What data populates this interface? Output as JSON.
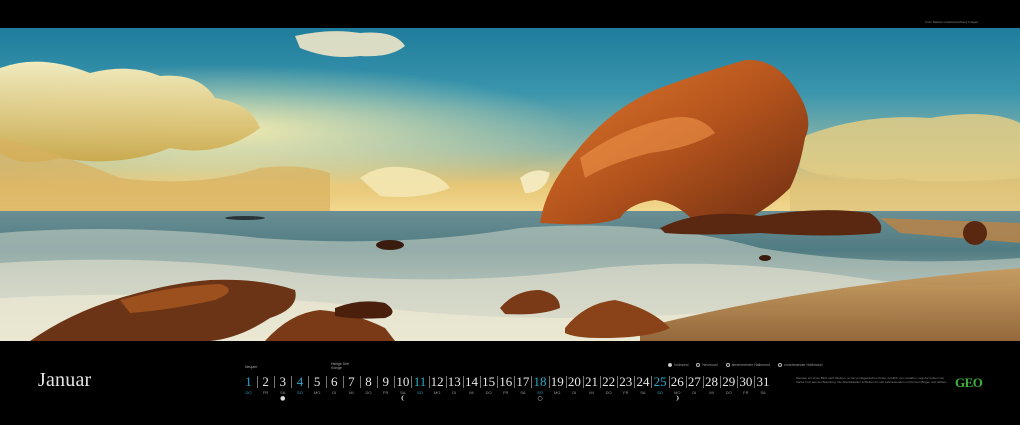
{
  "credit": "Foto: Markus Landsmann/Getty Images",
  "month": "Januar",
  "holidays": [
    {
      "day": 1,
      "label": "Neujahr"
    },
    {
      "day": 6,
      "label": "Heilige Drei Könige"
    }
  ],
  "moon_legend": [
    "Vollmond",
    "Neumond",
    "abnehmender Halbmond",
    "zunehmender Halbmond"
  ],
  "days": [
    {
      "n": "1",
      "wd": "DO",
      "blue": true
    },
    {
      "n": "2",
      "wd": "FR"
    },
    {
      "n": "3",
      "wd": "SA",
      "mark": "●"
    },
    {
      "n": "4",
      "wd": "SO",
      "blue": true
    },
    {
      "n": "5",
      "wd": "MO"
    },
    {
      "n": "6",
      "wd": "DI"
    },
    {
      "n": "7",
      "wd": "MI"
    },
    {
      "n": "8",
      "wd": "DO"
    },
    {
      "n": "9",
      "wd": "FR"
    },
    {
      "n": "10",
      "wd": "SA",
      "mark": "❨"
    },
    {
      "n": "11",
      "wd": "SO",
      "blue": true
    },
    {
      "n": "12",
      "wd": "MO"
    },
    {
      "n": "13",
      "wd": "DI"
    },
    {
      "n": "14",
      "wd": "MI"
    },
    {
      "n": "15",
      "wd": "DO"
    },
    {
      "n": "16",
      "wd": "FR"
    },
    {
      "n": "17",
      "wd": "SA"
    },
    {
      "n": "18",
      "wd": "SO",
      "blue": true,
      "mark": "○"
    },
    {
      "n": "19",
      "wd": "MO"
    },
    {
      "n": "20",
      "wd": "DI"
    },
    {
      "n": "21",
      "wd": "MI"
    },
    {
      "n": "22",
      "wd": "DO"
    },
    {
      "n": "23",
      "wd": "FR"
    },
    {
      "n": "24",
      "wd": "SA"
    },
    {
      "n": "25",
      "wd": "SO",
      "blue": true
    },
    {
      "n": "26",
      "wd": "MO",
      "mark": "❩"
    },
    {
      "n": "27",
      "wd": "DI"
    },
    {
      "n": "28",
      "wd": "MI"
    },
    {
      "n": "29",
      "wd": "DO"
    },
    {
      "n": "30",
      "wd": "FR"
    },
    {
      "n": "31",
      "wd": "SA"
    }
  ],
  "caption": "Wenden wir einen Blick nach Westen: an der portugiesischen Küste, nördlich von Lissabon, ragt der Felsen von Santa Cruz aus der Brandung. Die Atlantikwellen schleifen ihn seit Jahrtausenden und formen Bögen und Höhlen.",
  "brand": "GEO",
  "colors": {
    "sunday": "#2aa9c9",
    "brand": "#3db33d"
  }
}
